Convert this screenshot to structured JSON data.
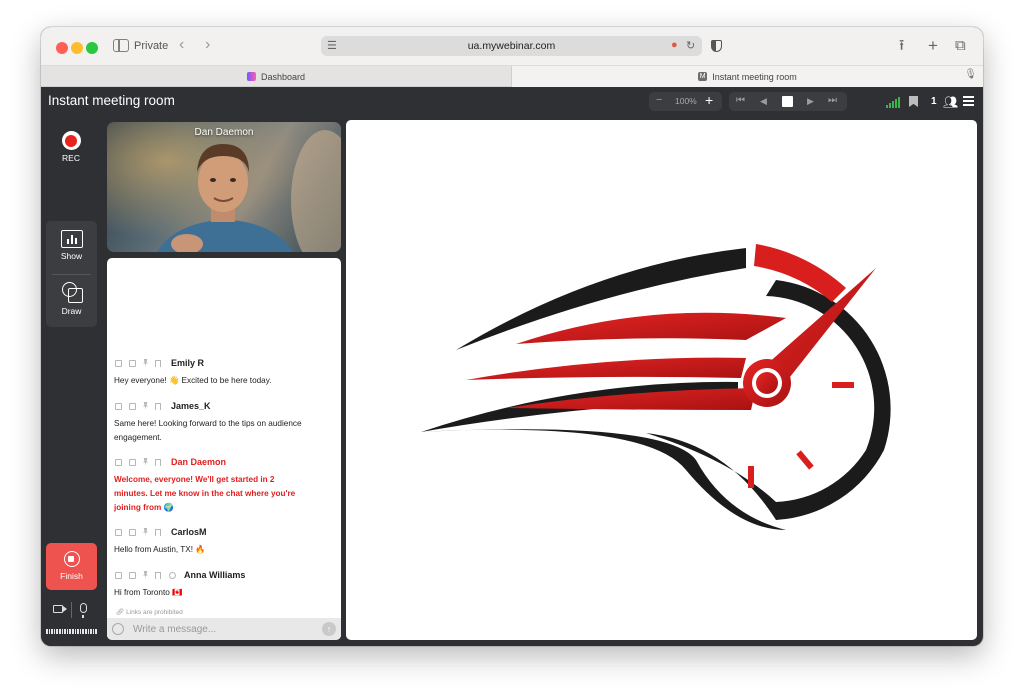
{
  "browser": {
    "mode_label": "Private",
    "url": "ua.mywebinar.com",
    "tabs": [
      {
        "label": "Dashboard"
      },
      {
        "label": "Instant meeting room"
      }
    ]
  },
  "app": {
    "title": "Instant meeting room",
    "zoom": "100%",
    "participants": "1"
  },
  "rail": {
    "rec_label": "REC",
    "show_label": "Show",
    "draw_label": "Draw",
    "finish_label": "Finish"
  },
  "video": {
    "speaker": "Dan Daemon"
  },
  "chat": {
    "messages": [
      {
        "author": "Emily R",
        "text": "Hey everyone! 👋 Excited to be here today."
      },
      {
        "author": "James_K",
        "text": "Same here! Looking forward to the tips on audience engagement."
      },
      {
        "author": "Dan Daemon",
        "text": "Welcome, everyone! We'll get started in 2 minutes. Let me know in the chat where you're joining from 🌍"
      },
      {
        "author": "CarlosM",
        "text": "Hello from Austin, TX! 🔥"
      },
      {
        "author": "Anna Williams",
        "text": "Hi from Toronto 🇨🇦"
      }
    ],
    "links_note": "Links are prohibited",
    "input_placeholder": "Write a message..."
  },
  "colors": {
    "accent_red": "#e02020",
    "finish_red": "#ef5350",
    "app_dark": "#2f3033",
    "signal_green": "#39b54a"
  },
  "icons": [
    "sidebar-icon",
    "back-icon",
    "forward-icon",
    "microphone-icon",
    "reload-icon",
    "shield-icon",
    "share-icon",
    "new-tab-icon",
    "tabs-overview-icon",
    "zoom-out-icon",
    "zoom-in-icon",
    "first-slide-icon",
    "prev-slide-icon",
    "stop-icon",
    "next-slide-icon",
    "last-slide-icon",
    "signal-icon",
    "bookmark-icon",
    "people-icon",
    "menu-icon",
    "record-icon",
    "presentation-icon",
    "draw-icon",
    "finish-icon",
    "camera-icon",
    "copy-icon",
    "delete-icon",
    "pin-icon",
    "clock-icon",
    "emoji-icon",
    "send-icon"
  ]
}
